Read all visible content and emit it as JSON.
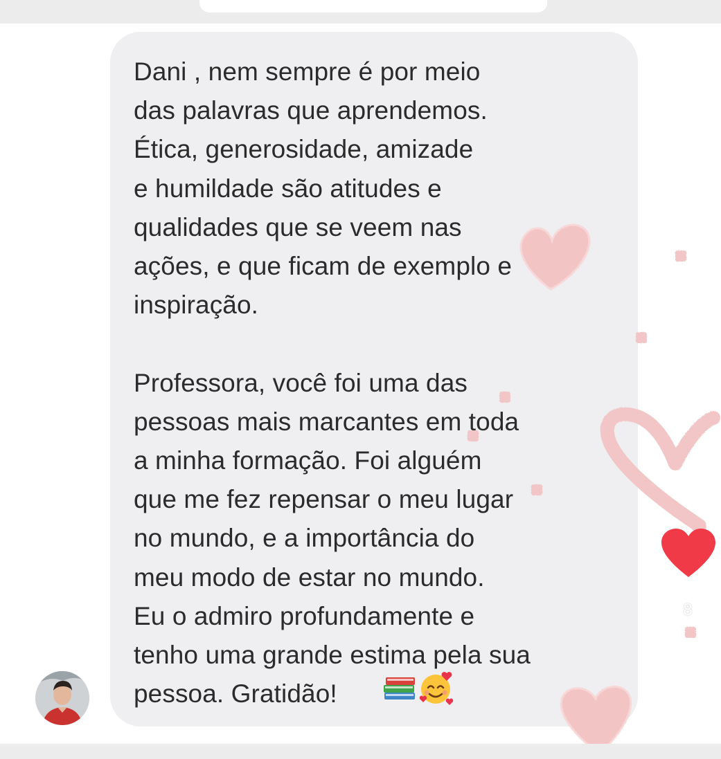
{
  "message": {
    "text": "Dani , nem sempre é por meio\ndas palavras que aprendemos.\nÉtica, generosidade, amizade\ne humildade são atitudes e\nqualidades que se veem nas\nações, e que ficam de exemplo e\ninspiração.\n\nProfessora, você foi uma das\npessoas mais marcantes em toda\na minha formação. Foi alguém\nque me fez repensar o meu lugar\nno mundo, e a importância do\nmeu modo de estar no mundo.\nEu o admiro profundamente e\ntenho uma grande estima pela sua\npessoa. Gratidão!",
    "emojis": [
      "books-emoji",
      "smiling-face-with-hearts-emoji"
    ]
  },
  "actions": {
    "like_count": "8"
  },
  "icons": {
    "like": "heart-icon",
    "comment": "comment-bubble-icon"
  },
  "colors": {
    "bubble": "#efeff1",
    "like_heart": "#f03a47",
    "sticker_heart": "#f2c6c6"
  }
}
